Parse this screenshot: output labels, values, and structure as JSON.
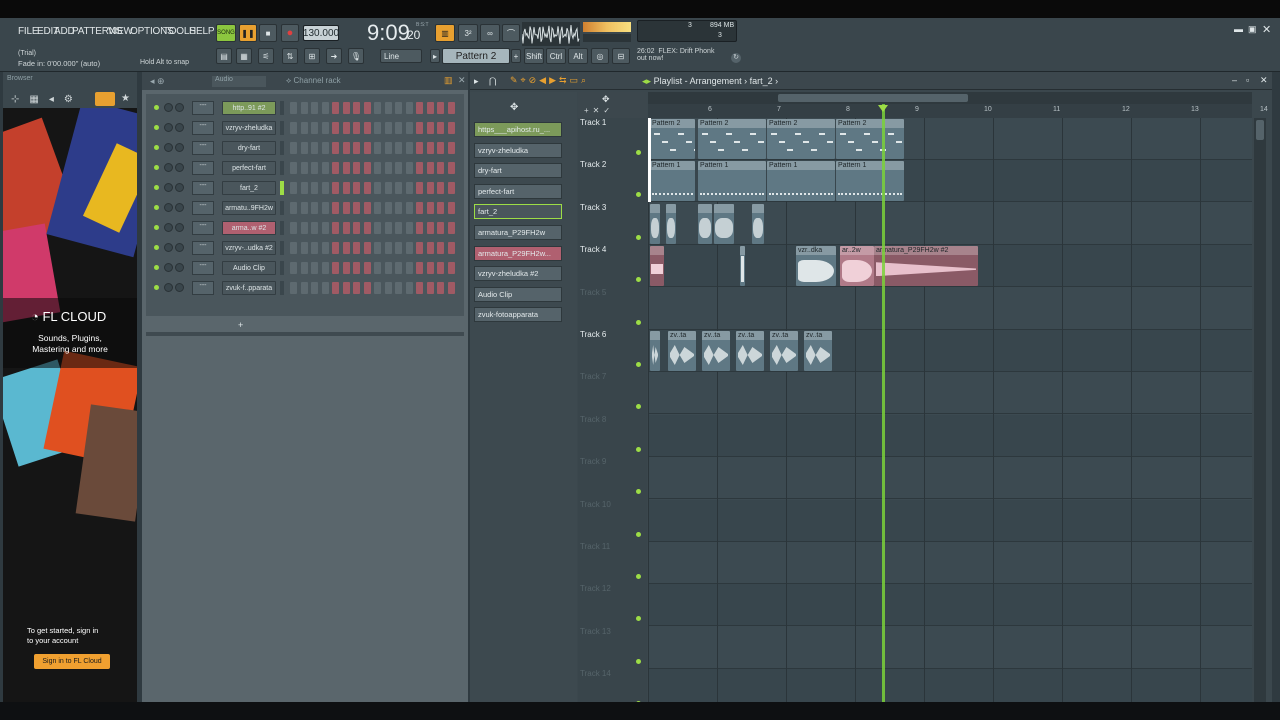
{
  "menu": [
    "FILE",
    "EDIT",
    "ADD",
    "PATTERNS",
    "VIEW",
    "OPTIONS",
    "TOOLS",
    "HELP"
  ],
  "transport": {
    "song_label": "SONG",
    "tempo": "130.000",
    "time": "9:09",
    "time_sub": "20",
    "time_unit": "B:S:T",
    "pattern": "Pattern 2",
    "snap": "Line"
  },
  "hints": {
    "trial": "(Trial)",
    "fade": "Fade in:  0'00.000\" (auto)",
    "snap_hint": "Hold Alt to snap"
  },
  "cpu": {
    "val1": "3",
    "mem": "894 MB",
    "val2": "3"
  },
  "news": {
    "time": "26:02",
    "line1": "FLEX: Drift Phonk",
    "line2": "out now!"
  },
  "modkeys": [
    "Shift",
    "Ctrl",
    "Alt"
  ],
  "browser": {
    "title": "Browser"
  },
  "promo": {
    "brand": "FL CLOUD",
    "tag1": "Sounds, Plugins,",
    "tag2": "Mastering and more",
    "cta1": "To get started, sign in",
    "cta2": "to your account",
    "button": "Sign in to FL Cloud"
  },
  "channel_rack": {
    "title": "Channel rack",
    "filter": "Audio",
    "channels": [
      {
        "name": "http..91 #2",
        "highlight": "green"
      },
      {
        "name": "vzryv-zheludka",
        "highlight": "none"
      },
      {
        "name": "dry-fart",
        "highlight": "none"
      },
      {
        "name": "perfect-fart",
        "highlight": "none"
      },
      {
        "name": "fart_2",
        "highlight": "none"
      },
      {
        "name": "armatu..9FH2w",
        "highlight": "none"
      },
      {
        "name": "arma..w #2",
        "highlight": "pink"
      },
      {
        "name": "vzryv-..udka #2",
        "highlight": "none"
      },
      {
        "name": "Audio Clip",
        "highlight": "none"
      },
      {
        "name": "zvuk-f..pparata",
        "highlight": "none"
      }
    ]
  },
  "playlist": {
    "title": "Playlist - Arrangement",
    "crumb": "fart_2",
    "picker": [
      "https___apihost.ru_...",
      "vzryv-zheludka",
      "dry-fart",
      "perfect-fart",
      "fart_2",
      "armatura_P29FH2w",
      "armatura_P29FH2w...",
      "vzryv-zheludka #2",
      "Audio Clip",
      "zvuk-fotoapparata"
    ],
    "ruler": [
      "6",
      "7",
      "8",
      "9",
      "10",
      "11",
      "12",
      "13",
      "14"
    ],
    "tracks": [
      "Track 1",
      "Track 2",
      "Track 3",
      "Track 4",
      "Track 5",
      "Track 6",
      "Track 7",
      "Track 8",
      "Track 9",
      "Track 10",
      "Track 11",
      "Track 12",
      "Track 13",
      "Track 14"
    ],
    "clip_labels": {
      "p2": "Pattern 2",
      "p1": "Pattern 1",
      "vzr": "vzr..dka",
      "arm": "ar..2w",
      "arm2": "armatura_P29FH2w #2",
      "zv": "zv..ta"
    }
  },
  "colors": {
    "accent_green": "#7ad13a",
    "clip_blue": "#6f8a96",
    "clip_pink": "#c77b8c",
    "promo_btn": "#f0a030"
  }
}
